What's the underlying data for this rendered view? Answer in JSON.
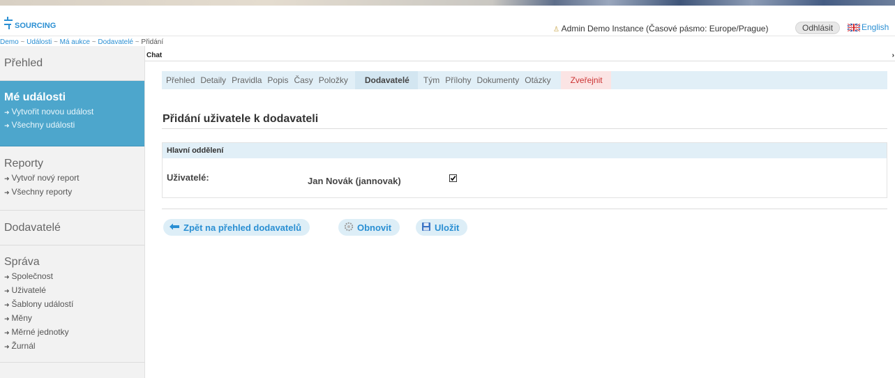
{
  "app": {
    "logo_text": "SOURCING"
  },
  "header": {
    "user_text": "Admin Demo Instance (Časové pásmo: Europe/Prague)",
    "logout_label": "Odhlásit",
    "language_label": "English"
  },
  "breadcrumb": {
    "items": [
      "Demo",
      "Události",
      "Má aukce",
      "Dodavatelé"
    ],
    "separator": " ~ ",
    "current": "Přidání"
  },
  "sidebar": {
    "overview": "Přehled",
    "my_events": {
      "title": "Mé události",
      "items": [
        "Vytvořit novou událost",
        "Všechny události"
      ]
    },
    "reports": {
      "title": "Reporty",
      "items": [
        "Vytvoř nový report",
        "Všechny reporty"
      ]
    },
    "suppliers": "Dodavatelé",
    "admin": {
      "title": "Správa",
      "items": [
        "Společnost",
        "Uživatelé",
        "Šablony událostí",
        "Měny",
        "Měrné jednotky",
        "Žurnál"
      ]
    }
  },
  "chat": {
    "label": "Chat"
  },
  "steps": {
    "items": [
      "Přehled",
      "Detaily",
      "Pravidla",
      "Popis",
      "Časy",
      "Položky",
      "Dodavatelé",
      "Tým",
      "Přílohy",
      "Dokumenty",
      "Otázky",
      "Zveřejnit"
    ],
    "active": "Dodavatelé"
  },
  "page": {
    "title": "Přidání uživatele k dodavateli",
    "section_title": "Hlavní oddělení",
    "users_label": "Uživatelé:",
    "user_name": "Jan Novák (jannovak)",
    "user_checked": true
  },
  "buttons": {
    "back": "Zpět na přehled dodavatelů",
    "refresh": "Obnovit",
    "save": "Uložit"
  },
  "colors": {
    "accent": "#2a8fd3",
    "sidebar_active": "#4da6cc",
    "panel_head": "#e1eff7"
  }
}
